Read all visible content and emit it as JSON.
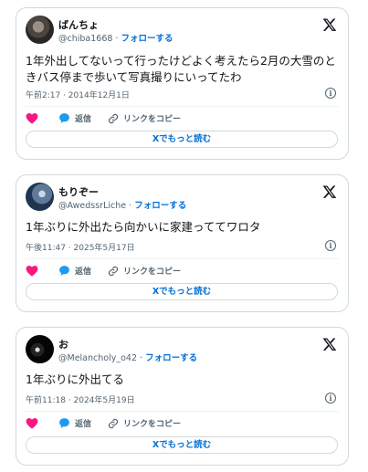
{
  "colors": {
    "border": "#cfd9de",
    "link_blue": "#006fd6",
    "heart_pink": "#f91880",
    "reply_blue": "#1d9bf0",
    "secondary_text": "#536471"
  },
  "tweets": [
    {
      "display_name": "ばんちょ",
      "handle": "@chiba1668",
      "separator": "·",
      "follow_label": "フォローする",
      "text": "1年外出してないって行ったけどよく考えたら2月の大雪のときバス停まで歩いて写真撮りにいってたわ",
      "timestamp": "午前2:17 · 2014年12月1日",
      "reply_label": "返信",
      "copy_link_label": "リンクをコピー",
      "read_more_label": "Xでもっと読む"
    },
    {
      "display_name": "もりぞー",
      "handle": "@AwedssrLiche",
      "separator": "·",
      "follow_label": "フォローする",
      "text": "1年ぶりに外出たら向かいに家建っててワロタ",
      "timestamp": "午後11:47 · 2025年5月17日",
      "reply_label": "返信",
      "copy_link_label": "リンクをコピー",
      "read_more_label": "Xでもっと読む"
    },
    {
      "display_name": "お",
      "handle": "@Melancholy_o42",
      "separator": "·",
      "follow_label": "フォローする",
      "text": "1年ぶりに外出てる",
      "timestamp": "午前11:18 · 2024年5月19日",
      "reply_label": "返信",
      "copy_link_label": "リンクをコピー",
      "read_more_label": "Xでもっと読む"
    }
  ],
  "icons": {
    "x_logo": "x-logo-icon",
    "info": "info-icon",
    "like": "heart-icon",
    "reply": "speech-bubble-icon",
    "copy_link": "link-icon"
  }
}
